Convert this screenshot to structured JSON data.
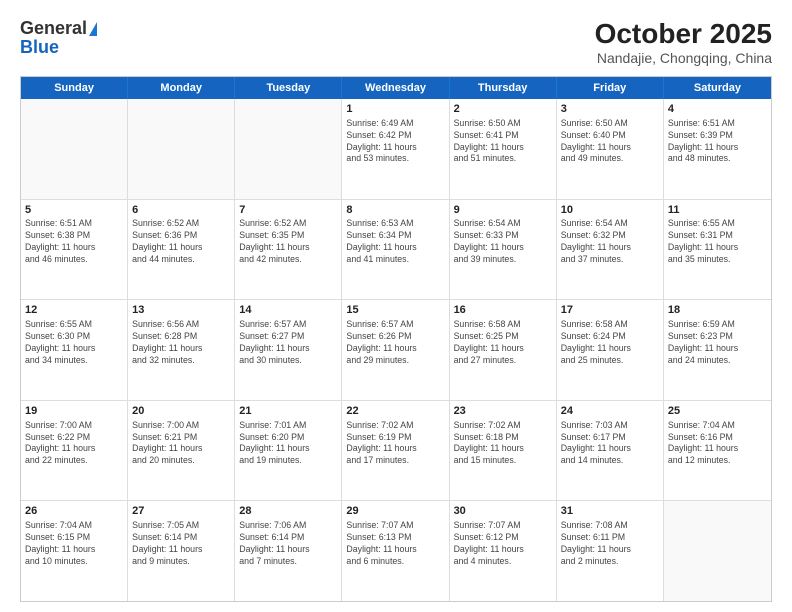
{
  "logo": {
    "line1": "General",
    "line2": "Blue"
  },
  "title": "October 2025",
  "subtitle": "Nandajie, Chongqing, China",
  "header_days": [
    "Sunday",
    "Monday",
    "Tuesday",
    "Wednesday",
    "Thursday",
    "Friday",
    "Saturday"
  ],
  "weeks": [
    [
      {
        "day": "",
        "info": ""
      },
      {
        "day": "",
        "info": ""
      },
      {
        "day": "",
        "info": ""
      },
      {
        "day": "1",
        "info": "Sunrise: 6:49 AM\nSunset: 6:42 PM\nDaylight: 11 hours\nand 53 minutes."
      },
      {
        "day": "2",
        "info": "Sunrise: 6:50 AM\nSunset: 6:41 PM\nDaylight: 11 hours\nand 51 minutes."
      },
      {
        "day": "3",
        "info": "Sunrise: 6:50 AM\nSunset: 6:40 PM\nDaylight: 11 hours\nand 49 minutes."
      },
      {
        "day": "4",
        "info": "Sunrise: 6:51 AM\nSunset: 6:39 PM\nDaylight: 11 hours\nand 48 minutes."
      }
    ],
    [
      {
        "day": "5",
        "info": "Sunrise: 6:51 AM\nSunset: 6:38 PM\nDaylight: 11 hours\nand 46 minutes."
      },
      {
        "day": "6",
        "info": "Sunrise: 6:52 AM\nSunset: 6:36 PM\nDaylight: 11 hours\nand 44 minutes."
      },
      {
        "day": "7",
        "info": "Sunrise: 6:52 AM\nSunset: 6:35 PM\nDaylight: 11 hours\nand 42 minutes."
      },
      {
        "day": "8",
        "info": "Sunrise: 6:53 AM\nSunset: 6:34 PM\nDaylight: 11 hours\nand 41 minutes."
      },
      {
        "day": "9",
        "info": "Sunrise: 6:54 AM\nSunset: 6:33 PM\nDaylight: 11 hours\nand 39 minutes."
      },
      {
        "day": "10",
        "info": "Sunrise: 6:54 AM\nSunset: 6:32 PM\nDaylight: 11 hours\nand 37 minutes."
      },
      {
        "day": "11",
        "info": "Sunrise: 6:55 AM\nSunset: 6:31 PM\nDaylight: 11 hours\nand 35 minutes."
      }
    ],
    [
      {
        "day": "12",
        "info": "Sunrise: 6:55 AM\nSunset: 6:30 PM\nDaylight: 11 hours\nand 34 minutes."
      },
      {
        "day": "13",
        "info": "Sunrise: 6:56 AM\nSunset: 6:28 PM\nDaylight: 11 hours\nand 32 minutes."
      },
      {
        "day": "14",
        "info": "Sunrise: 6:57 AM\nSunset: 6:27 PM\nDaylight: 11 hours\nand 30 minutes."
      },
      {
        "day": "15",
        "info": "Sunrise: 6:57 AM\nSunset: 6:26 PM\nDaylight: 11 hours\nand 29 minutes."
      },
      {
        "day": "16",
        "info": "Sunrise: 6:58 AM\nSunset: 6:25 PM\nDaylight: 11 hours\nand 27 minutes."
      },
      {
        "day": "17",
        "info": "Sunrise: 6:58 AM\nSunset: 6:24 PM\nDaylight: 11 hours\nand 25 minutes."
      },
      {
        "day": "18",
        "info": "Sunrise: 6:59 AM\nSunset: 6:23 PM\nDaylight: 11 hours\nand 24 minutes."
      }
    ],
    [
      {
        "day": "19",
        "info": "Sunrise: 7:00 AM\nSunset: 6:22 PM\nDaylight: 11 hours\nand 22 minutes."
      },
      {
        "day": "20",
        "info": "Sunrise: 7:00 AM\nSunset: 6:21 PM\nDaylight: 11 hours\nand 20 minutes."
      },
      {
        "day": "21",
        "info": "Sunrise: 7:01 AM\nSunset: 6:20 PM\nDaylight: 11 hours\nand 19 minutes."
      },
      {
        "day": "22",
        "info": "Sunrise: 7:02 AM\nSunset: 6:19 PM\nDaylight: 11 hours\nand 17 minutes."
      },
      {
        "day": "23",
        "info": "Sunrise: 7:02 AM\nSunset: 6:18 PM\nDaylight: 11 hours\nand 15 minutes."
      },
      {
        "day": "24",
        "info": "Sunrise: 7:03 AM\nSunset: 6:17 PM\nDaylight: 11 hours\nand 14 minutes."
      },
      {
        "day": "25",
        "info": "Sunrise: 7:04 AM\nSunset: 6:16 PM\nDaylight: 11 hours\nand 12 minutes."
      }
    ],
    [
      {
        "day": "26",
        "info": "Sunrise: 7:04 AM\nSunset: 6:15 PM\nDaylight: 11 hours\nand 10 minutes."
      },
      {
        "day": "27",
        "info": "Sunrise: 7:05 AM\nSunset: 6:14 PM\nDaylight: 11 hours\nand 9 minutes."
      },
      {
        "day": "28",
        "info": "Sunrise: 7:06 AM\nSunset: 6:14 PM\nDaylight: 11 hours\nand 7 minutes."
      },
      {
        "day": "29",
        "info": "Sunrise: 7:07 AM\nSunset: 6:13 PM\nDaylight: 11 hours\nand 6 minutes."
      },
      {
        "day": "30",
        "info": "Sunrise: 7:07 AM\nSunset: 6:12 PM\nDaylight: 11 hours\nand 4 minutes."
      },
      {
        "day": "31",
        "info": "Sunrise: 7:08 AM\nSunset: 6:11 PM\nDaylight: 11 hours\nand 2 minutes."
      },
      {
        "day": "",
        "info": ""
      }
    ]
  ]
}
